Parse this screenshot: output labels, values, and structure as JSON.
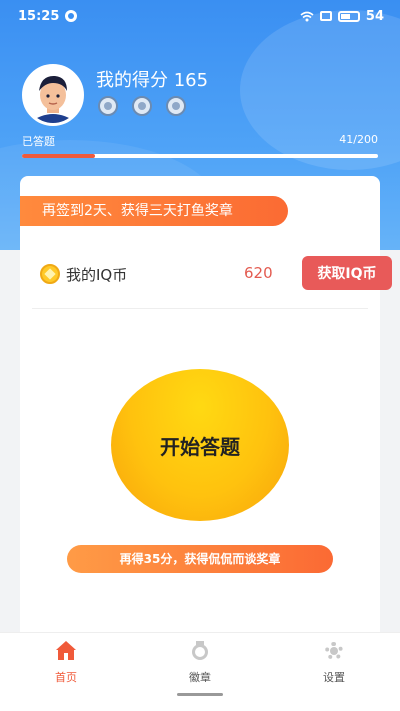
{
  "status_bar": {
    "time": "15:25",
    "battery": "54"
  },
  "profile": {
    "name": "我的得分 165",
    "badges": [
      "badge-1-icon",
      "badge-2-icon",
      "badge-3-icon"
    ]
  },
  "progress": {
    "label": "已答题",
    "count_text": "41/200",
    "answered": 41,
    "total": 200
  },
  "card": {
    "ribbon_text": "再签到2天、获得三天打鱼奖章",
    "coin_label": "我的IQ币",
    "coin_value": "620",
    "coin_button": "获取IQ币",
    "start_button": "开始答题",
    "goal_text": "再得35分，获得侃侃而谈奖章"
  },
  "nav": {
    "items": [
      {
        "label": "首页",
        "icon": "home-icon",
        "active": true
      },
      {
        "label": "徽章",
        "icon": "medal-icon",
        "active": false
      },
      {
        "label": "设置",
        "icon": "gear-icon",
        "active": false
      }
    ]
  },
  "colors": {
    "header_blue": "#3a8ff2",
    "accent_orange": "#fb6b33",
    "coin_red": "#e85a59",
    "start_yellow": "#ffc20e"
  }
}
